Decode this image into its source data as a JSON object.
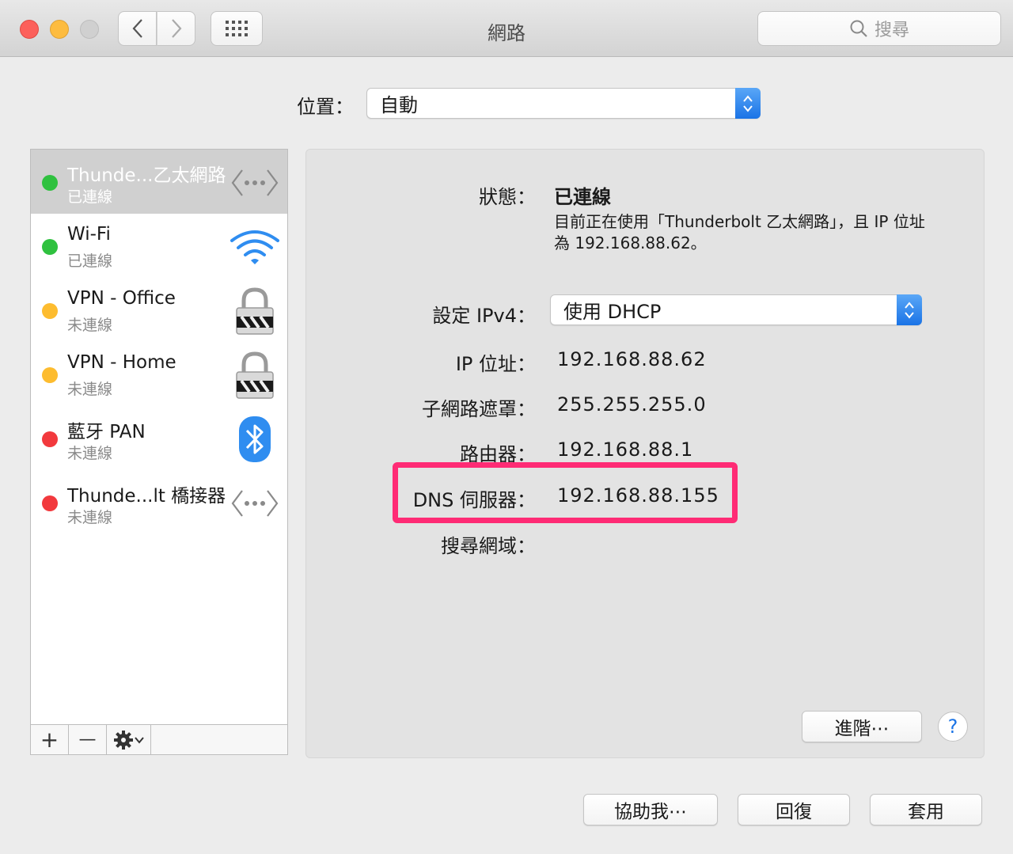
{
  "window": {
    "title": "網路"
  },
  "toolbar": {
    "search_placeholder": "搜尋"
  },
  "location": {
    "label": "位置：",
    "value": "自動"
  },
  "services": [
    {
      "name": "Thunde...乙太網路",
      "status": "已連線",
      "status_color": "#2fc13f",
      "icon": "ethernet-icon",
      "selected": true
    },
    {
      "name": "Wi-Fi",
      "status": "已連線",
      "status_color": "#2fc13f",
      "icon": "wifi-icon"
    },
    {
      "name": "VPN - Office",
      "status": "未連線",
      "status_color": "#fdbc2f",
      "icon": "vpn-lock-icon"
    },
    {
      "name": "VPN - Home",
      "status": "未連線",
      "status_color": "#fdbc2f",
      "icon": "vpn-lock-icon"
    },
    {
      "name": "藍牙 PAN",
      "status": "未連線",
      "status_color": "#f2393d",
      "icon": "bluetooth-icon"
    },
    {
      "name": "Thunde...lt 橋接器",
      "status": "未連線",
      "status_color": "#f2393d",
      "icon": "ethernet-icon"
    }
  ],
  "sidebar_footer": {
    "add": "+",
    "remove": "—"
  },
  "detail": {
    "status_label": "狀態：",
    "status_value": "已連線",
    "status_desc": "目前正在使用「Thunderbolt 乙太網路」，且 IP 位址為 192.168.88.62。",
    "ipv4_label": "設定 IPv4：",
    "ipv4_value": "使用 DHCP",
    "ip_label": "IP 位址：",
    "ip_value": "192.168.88.62",
    "subnet_label": "子網路遮罩：",
    "subnet_value": "255.255.255.0",
    "router_label": "路由器：",
    "router_value": "192.168.88.1",
    "dns_label": "DNS 伺服器：",
    "dns_value": "192.168.88.155",
    "search_domain_label": "搜尋網域：",
    "advanced_button": "進階⋯",
    "help_button": "?"
  },
  "footer_buttons": {
    "assist": "協助我⋯",
    "revert": "回復",
    "apply": "套用"
  },
  "colors": {
    "highlight": "#ff2b75",
    "accent": "#1a73e6"
  }
}
